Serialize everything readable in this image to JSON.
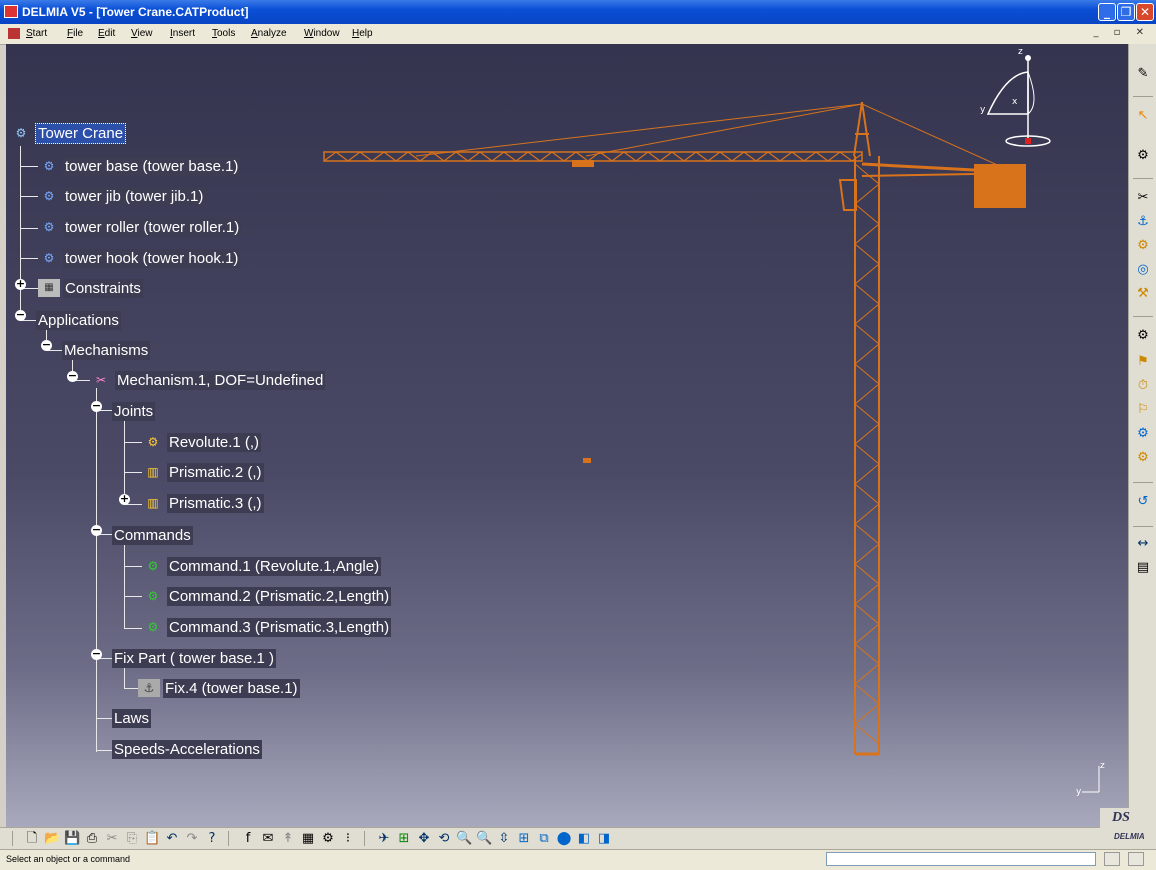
{
  "window": {
    "title": "DELMIA V5 - [Tower Crane.CATProduct]",
    "controls": [
      "minimize",
      "restore",
      "close"
    ]
  },
  "menu": {
    "items": [
      "Start",
      "File",
      "Edit",
      "View",
      "Insert",
      "Tools",
      "Analyze",
      "Window",
      "Help"
    ]
  },
  "tree": {
    "root": "Tower Crane",
    "parts": [
      "tower base (tower base.1)",
      "tower jib (tower jib.1)",
      "tower roller (tower roller.1)",
      "tower hook (tower hook.1)"
    ],
    "constraints": "Constraints",
    "applications": "Applications",
    "mechanisms": "Mechanisms",
    "mechanism": "Mechanism.1, DOF=Undefined",
    "joints": "Joints",
    "joint_items": [
      "Revolute.1 (,)",
      "Prismatic.2 (,)",
      "Prismatic.3 (,)"
    ],
    "commands": "Commands",
    "command_items": [
      "Command.1 (Revolute.1,Angle)",
      "Command.2 (Prismatic.2,Length)",
      "Command.3 (Prismatic.3,Length)"
    ],
    "fix_part": "Fix Part ( tower base.1 )",
    "fix_item": "Fix.4 (tower base.1)",
    "laws": "Laws",
    "speeds": "Speeds-Accelerations"
  },
  "compass_axes": {
    "x": "x",
    "y": "y",
    "z": "z"
  },
  "mini_axes": {
    "z": "z",
    "y": "y"
  },
  "logo": {
    "brand": "DELMIA",
    "mark": "DS"
  },
  "status": {
    "message": "Select an object or a command"
  },
  "colors": {
    "crane": "#d9731b",
    "viewport_top": "#34344f",
    "viewport_bottom": "#a9a9bd",
    "selection": "#2c4faa"
  }
}
